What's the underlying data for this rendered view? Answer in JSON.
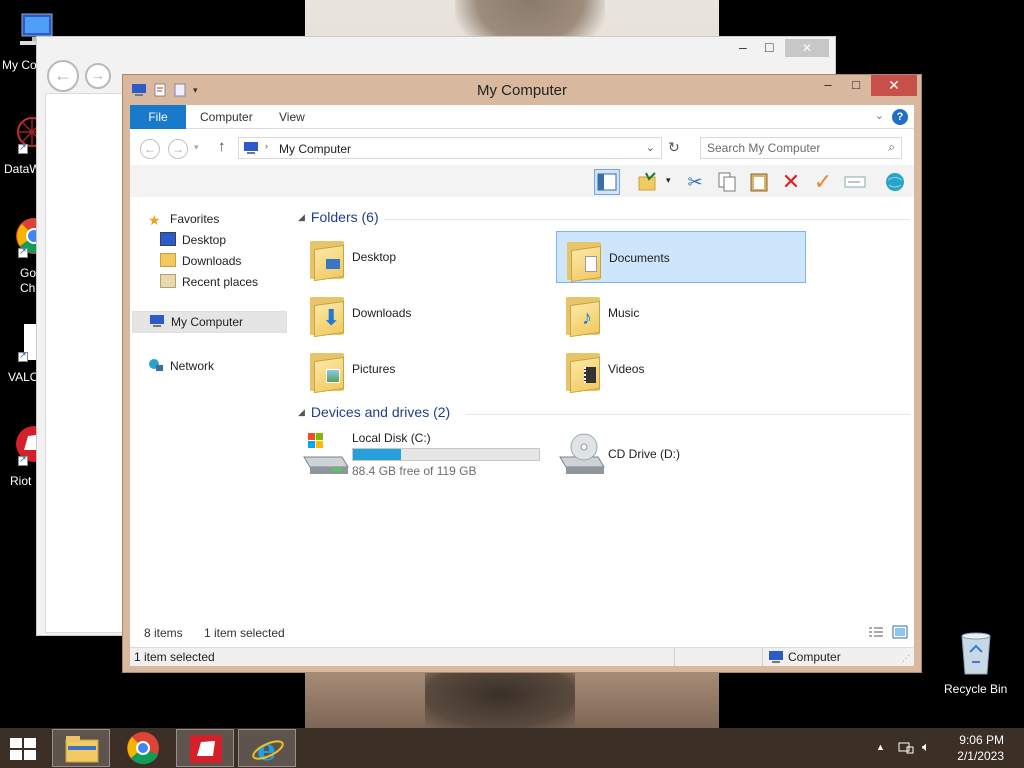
{
  "desktop": {
    "icons": [
      {
        "label": "My Co"
      },
      {
        "label": "DataW"
      },
      {
        "label": "Goo\nChr"
      },
      {
        "label": "VALO"
      },
      {
        "label": "Riot"
      },
      {
        "label": "Recycle Bin"
      }
    ]
  },
  "window": {
    "title": "My Computer",
    "controls": {
      "minimize": "–",
      "maximize": "□",
      "close": "✕"
    }
  },
  "ribbon": {
    "tabs": [
      "File",
      "Computer",
      "View"
    ],
    "help": "?"
  },
  "address": {
    "path": "My Computer",
    "search_placeholder": "Search My Computer"
  },
  "navpane": {
    "favorites": "Favorites",
    "desktop": "Desktop",
    "downloads": "Downloads",
    "recent": "Recent places",
    "mycomputer": "My Computer",
    "network": "Network"
  },
  "content": {
    "folders_header": "Folders (6)",
    "folders": [
      "Desktop",
      "Documents",
      "Downloads",
      "Music",
      "Pictures",
      "Videos"
    ],
    "devices_header": "Devices and drives (2)",
    "drives": {
      "c_label": "Local Disk (C:)",
      "c_free": "88.4 GB free of 119 GB",
      "c_used_fraction": 0.26,
      "d_label": "CD Drive (D:)"
    }
  },
  "status": {
    "items": "8 items",
    "selected": "1 item selected",
    "bottom_selected": "1 item selected",
    "location": "Computer"
  },
  "taskbar": {
    "time": "9:06 PM",
    "date": "2/1/2023"
  },
  "colors": {
    "accent": "#1979ca",
    "window_frame": "#d8b9a0",
    "close": "#c7504a",
    "selection": "#cde6fb",
    "drive_bar": "#26a0da"
  }
}
